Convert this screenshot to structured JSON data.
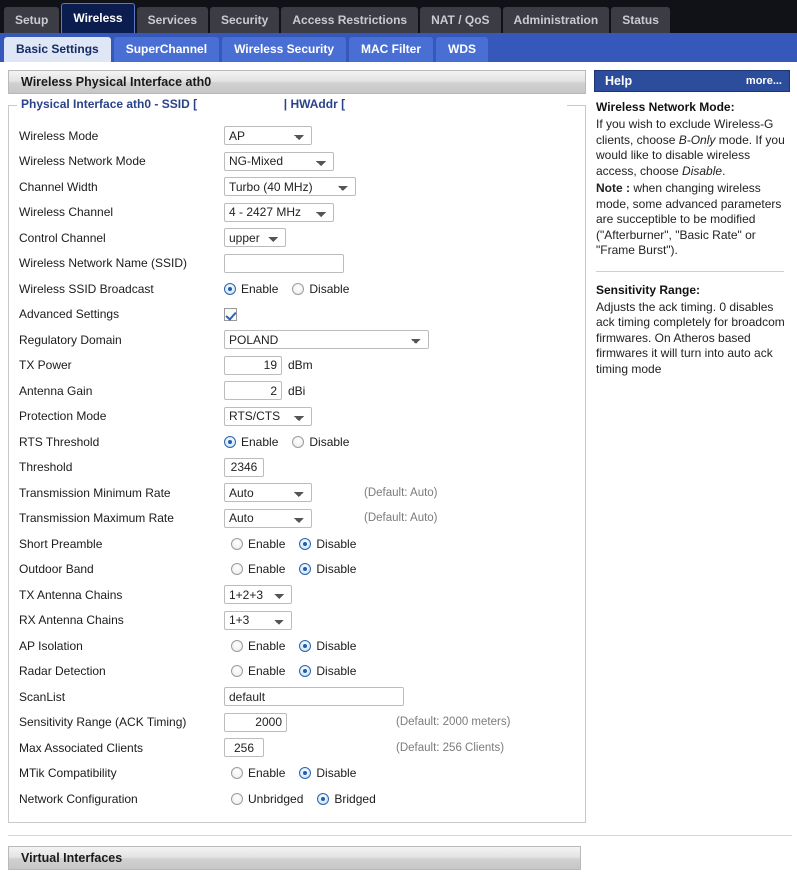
{
  "topnav": {
    "tabs": [
      {
        "label": "Setup",
        "active": false
      },
      {
        "label": "Wireless",
        "active": true
      },
      {
        "label": "Services",
        "active": false
      },
      {
        "label": "Security",
        "active": false
      },
      {
        "label": "Access Restrictions",
        "active": false
      },
      {
        "label": "NAT / QoS",
        "active": false
      },
      {
        "label": "Administration",
        "active": false
      },
      {
        "label": "Status",
        "active": false
      }
    ]
  },
  "subnav": {
    "tabs": [
      {
        "label": "Basic Settings",
        "active": true
      },
      {
        "label": "SuperChannel",
        "active": false
      },
      {
        "label": "Wireless Security",
        "active": false
      },
      {
        "label": "MAC Filter",
        "active": false
      },
      {
        "label": "WDS",
        "active": false
      }
    ]
  },
  "section": {
    "title": "Wireless Physical Interface ath0",
    "legend": "Physical Interface ath0 - SSID [                          | HWAddr ["
  },
  "form": {
    "wireless_mode": {
      "label": "Wireless Mode",
      "value": "AP"
    },
    "wireless_network_mode": {
      "label": "Wireless Network Mode",
      "value": "NG-Mixed"
    },
    "channel_width": {
      "label": "Channel Width",
      "value": "Turbo (40 MHz)"
    },
    "wireless_channel": {
      "label": "Wireless Channel",
      "value": "4 - 2427 MHz"
    },
    "control_channel": {
      "label": "Control Channel",
      "value": "upper"
    },
    "ssid": {
      "label": "Wireless Network Name (SSID)",
      "value": ""
    },
    "ssid_broadcast": {
      "label": "Wireless SSID Broadcast",
      "enable": "Enable",
      "disable": "Disable",
      "selected": "Enable"
    },
    "advanced_settings": {
      "label": "Advanced Settings",
      "checked": true
    },
    "regulatory_domain": {
      "label": "Regulatory Domain",
      "value": "POLAND"
    },
    "tx_power": {
      "label": "TX Power",
      "value": "19",
      "unit": "dBm"
    },
    "antenna_gain": {
      "label": "Antenna Gain",
      "value": "2",
      "unit": "dBi"
    },
    "protection_mode": {
      "label": "Protection Mode",
      "value": "RTS/CTS"
    },
    "rts_threshold": {
      "label": "RTS Threshold",
      "enable": "Enable",
      "disable": "Disable",
      "selected": "Enable"
    },
    "threshold": {
      "label": "Threshold",
      "value": "2346"
    },
    "tx_min_rate": {
      "label": "Transmission Minimum Rate",
      "value": "Auto",
      "hint": "(Default: Auto)"
    },
    "tx_max_rate": {
      "label": "Transmission Maximum Rate",
      "value": "Auto",
      "hint": "(Default: Auto)"
    },
    "short_preamble": {
      "label": "Short Preamble",
      "enable": "Enable",
      "disable": "Disable",
      "selected": "Disable"
    },
    "outdoor_band": {
      "label": "Outdoor Band",
      "enable": "Enable",
      "disable": "Disable",
      "selected": "Disable"
    },
    "tx_antenna_chains": {
      "label": "TX Antenna Chains",
      "value": "1+2+3"
    },
    "rx_antenna_chains": {
      "label": "RX Antenna Chains",
      "value": "1+3"
    },
    "ap_isolation": {
      "label": "AP Isolation",
      "enable": "Enable",
      "disable": "Disable",
      "selected": "Disable"
    },
    "radar_detection": {
      "label": "Radar Detection",
      "enable": "Enable",
      "disable": "Disable",
      "selected": "Disable"
    },
    "scanlist": {
      "label": "ScanList",
      "value": "default"
    },
    "sensitivity_range": {
      "label": "Sensitivity Range (ACK Timing)",
      "value": "2000",
      "hint": "(Default: 2000 meters)"
    },
    "max_clients": {
      "label": "Max Associated Clients",
      "value": "256",
      "hint": "(Default: 256 Clients)"
    },
    "mtik_compatibility": {
      "label": "MTik Compatibility",
      "enable": "Enable",
      "disable": "Disable",
      "selected": "Disable"
    },
    "network_configuration": {
      "label": "Network Configuration",
      "enable": "Unbridged",
      "disable": "Bridged",
      "selected": "Bridged"
    }
  },
  "virtual_interfaces": {
    "title": "Virtual Interfaces"
  },
  "help": {
    "title": "Help",
    "more": "more...",
    "topic1_heading": "Wireless Network Mode:",
    "topic1_p1_a": "If you wish to exclude Wireless-G clients, choose ",
    "topic1_p1_i1": "B-Only",
    "topic1_p1_b": " mode. If you would like to disable wireless access, choose ",
    "topic1_p1_i2": "Disable",
    "topic1_p1_c": ".",
    "topic1_note_label": "Note :",
    "topic1_note_text": " when changing wireless mode, some advanced parameters are succeptible to be modified (\"Afterburner\", \"Basic Rate\" or \"Frame Burst\").",
    "topic2_heading": "Sensitivity Range:",
    "topic2_p1": "Adjusts the ack timing. 0 disables ack timing completely for broadcom firmwares. On Atheros based firmwares it will turn into auto ack timing mode"
  },
  "colors": {
    "topnav_bg": "#111218",
    "topnav_active": "#0b1c4e",
    "subnav_bg": "#3558ba",
    "subnav_tab": "#4a6fd4",
    "help_header": "#2c4d9b",
    "legend_text": "#2b4388"
  }
}
